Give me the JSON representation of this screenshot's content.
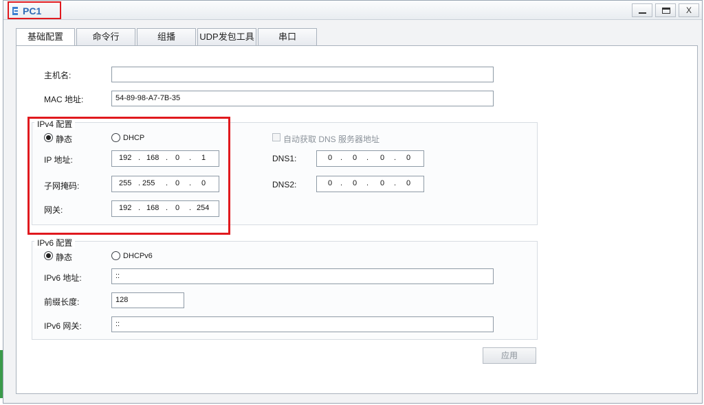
{
  "window": {
    "title": "PC1",
    "close_label": "X"
  },
  "tabs": [
    {
      "label": "基础配置",
      "active": true
    },
    {
      "label": "命令行"
    },
    {
      "label": "组播"
    },
    {
      "label": "UDP发包工具"
    },
    {
      "label": "串口"
    }
  ],
  "basic": {
    "hostname_label": "主机名:",
    "hostname_value": "",
    "mac_label": "MAC 地址:",
    "mac_value": "54-89-98-A7-7B-35"
  },
  "ipv4": {
    "group_title": "IPv4 配置",
    "static_label": "静态",
    "dhcp_label": "DHCP",
    "mode": "static",
    "auto_dns_label": "自动获取 DNS 服务器地址",
    "ip_label": "IP 地址:",
    "ip": [
      "192",
      "168",
      "0",
      "1"
    ],
    "mask_label": "子网掩码:",
    "mask": [
      "255",
      "255",
      "0",
      "0"
    ],
    "gateway_label": "网关:",
    "gateway": [
      "192",
      "168",
      "0",
      "254"
    ],
    "dns1_label": "DNS1:",
    "dns1": [
      "0",
      "0",
      "0",
      "0"
    ],
    "dns2_label": "DNS2:",
    "dns2": [
      "0",
      "0",
      "0",
      "0"
    ]
  },
  "ipv6": {
    "group_title": "IPv6 配置",
    "static_label": "静态",
    "dhcp_label": "DHCPv6",
    "mode": "static",
    "ip_label": "IPv6 地址:",
    "ip_value": "::",
    "prefix_label": "前缀长度:",
    "prefix_value": "128",
    "gateway_label": "IPv6 网关:",
    "gateway_value": "::"
  },
  "apply_label": "应用",
  "colors": {
    "highlight": "#e0191e",
    "title_text": "#2f6ab5"
  }
}
